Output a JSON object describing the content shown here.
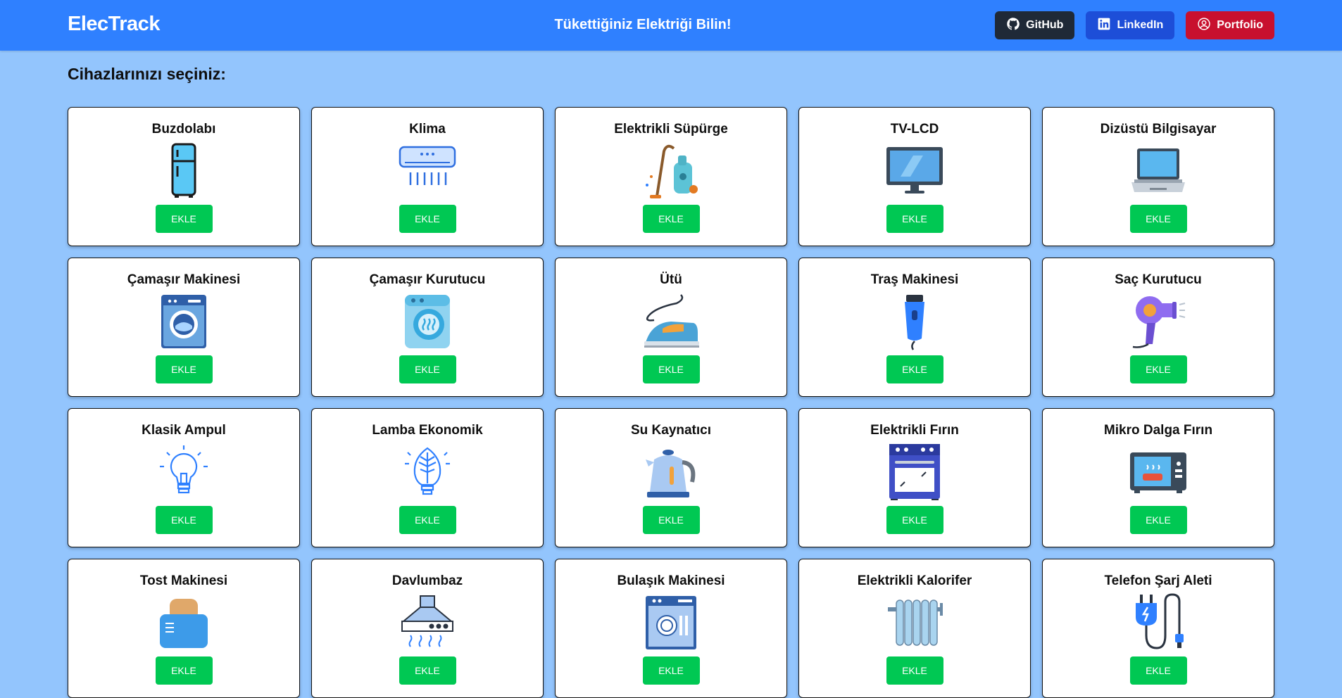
{
  "navbar": {
    "brand": "ElecTrack",
    "tagline": "Tükettiğiniz Elektriği Bilin!",
    "links": [
      {
        "label": "GitHub",
        "icon": "github-icon",
        "color": "#1f2937"
      },
      {
        "label": "LinkedIn",
        "icon": "linkedin-icon",
        "color": "#1d4ed8"
      },
      {
        "label": "Portfolio",
        "icon": "user-circle-icon",
        "color": "#c8102e"
      }
    ],
    "background": "#2f80ff"
  },
  "page": {
    "section_title": "Cihazlarınızı seçiniz:",
    "background": "#93c5fd"
  },
  "devices": [
    {
      "name": "Buzdolabı",
      "icon": "refrigerator-icon",
      "button": "EKLE"
    },
    {
      "name": "Klima",
      "icon": "air-conditioner-icon",
      "button": "EKLE"
    },
    {
      "name": "Elektrikli Süpürge",
      "icon": "vacuum-cleaner-icon",
      "button": "EKLE"
    },
    {
      "name": "TV-LCD",
      "icon": "tv-icon",
      "button": "EKLE"
    },
    {
      "name": "Dizüstü Bilgisayar",
      "icon": "laptop-icon",
      "button": "EKLE"
    },
    {
      "name": "Çamaşır Makinesi",
      "icon": "washing-machine-icon",
      "button": "EKLE"
    },
    {
      "name": "Çamaşır Kurutucu",
      "icon": "dryer-icon",
      "button": "EKLE"
    },
    {
      "name": "Ütü",
      "icon": "iron-icon",
      "button": "EKLE"
    },
    {
      "name": "Traş Makinesi",
      "icon": "shaver-icon",
      "button": "EKLE"
    },
    {
      "name": "Saç Kurutucu",
      "icon": "hair-dryer-icon",
      "button": "EKLE"
    },
    {
      "name": "Klasik Ampul",
      "icon": "light-bulb-icon",
      "button": "EKLE"
    },
    {
      "name": "Lamba Ekonomik",
      "icon": "eco-bulb-icon",
      "button": "EKLE"
    },
    {
      "name": "Su Kaynatıcı",
      "icon": "kettle-icon",
      "button": "EKLE"
    },
    {
      "name": "Elektrikli Fırın",
      "icon": "oven-icon",
      "button": "EKLE"
    },
    {
      "name": "Mikro Dalga Fırın",
      "icon": "microwave-icon",
      "button": "EKLE"
    },
    {
      "name": "Tost Makinesi",
      "icon": "toaster-icon",
      "button": "EKLE"
    },
    {
      "name": "Davlumbaz",
      "icon": "range-hood-icon",
      "button": "EKLE"
    },
    {
      "name": "Bulaşık Makinesi",
      "icon": "dishwasher-icon",
      "button": "EKLE"
    },
    {
      "name": "Elektrikli Kalorifer",
      "icon": "radiator-icon",
      "button": "EKLE"
    },
    {
      "name": "Telefon Şarj Aleti",
      "icon": "phone-charger-icon",
      "button": "EKLE"
    }
  ],
  "accent_add_button": "#00c853"
}
